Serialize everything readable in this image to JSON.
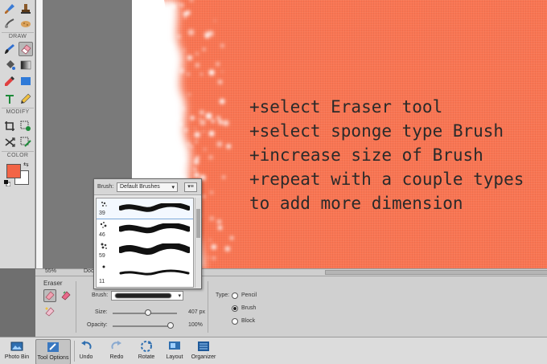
{
  "toolbox": {
    "draw_label": "DRAW",
    "modify_label": "MODIFY",
    "color_label": "COLOR",
    "foreground_color": "#f26446",
    "background_color": "#ffffff"
  },
  "canvas": {
    "base_color": "#f97552",
    "overlay_lines": [
      "+select Eraser tool",
      "+select sponge type Brush",
      "+increase size of Brush",
      "+repeat with a couple types",
      "to add more dimension"
    ]
  },
  "status": {
    "zoom": "55%",
    "doc": "Doc"
  },
  "brush_picker": {
    "label": "Brush:",
    "set_name": "Default Brushes",
    "menu_icon": "panel-menu-icon",
    "brushes": [
      {
        "size": "39",
        "selected": true
      },
      {
        "size": "46",
        "selected": false
      },
      {
        "size": "59",
        "selected": false
      },
      {
        "size": "11",
        "selected": false
      }
    ]
  },
  "tool_options": {
    "title": "Eraser",
    "brush_label": "Brush:",
    "size_label": "Size:",
    "size_value": "407 px",
    "opacity_label": "Opacity:",
    "opacity_value": "100%",
    "size_fraction": 0.55,
    "opacity_fraction": 1.0,
    "type_label": "Type:",
    "types": [
      {
        "label": "Pencil",
        "selected": false
      },
      {
        "label": "Brush",
        "selected": true
      },
      {
        "label": "Block",
        "selected": false
      }
    ]
  },
  "taskbar": {
    "items": [
      {
        "label": "Photo Bin",
        "icon": "photo-bin-icon",
        "active": false
      },
      {
        "label": "Tool Options",
        "icon": "tool-options-icon",
        "active": true
      },
      {
        "label": "Undo",
        "icon": "undo-icon",
        "active": false
      },
      {
        "label": "Redo",
        "icon": "redo-icon",
        "active": false
      },
      {
        "label": "Rotate",
        "icon": "rotate-icon",
        "active": false
      },
      {
        "label": "Layout",
        "icon": "layout-icon",
        "active": false
      },
      {
        "label": "Organizer",
        "icon": "organizer-icon",
        "active": false
      }
    ]
  }
}
